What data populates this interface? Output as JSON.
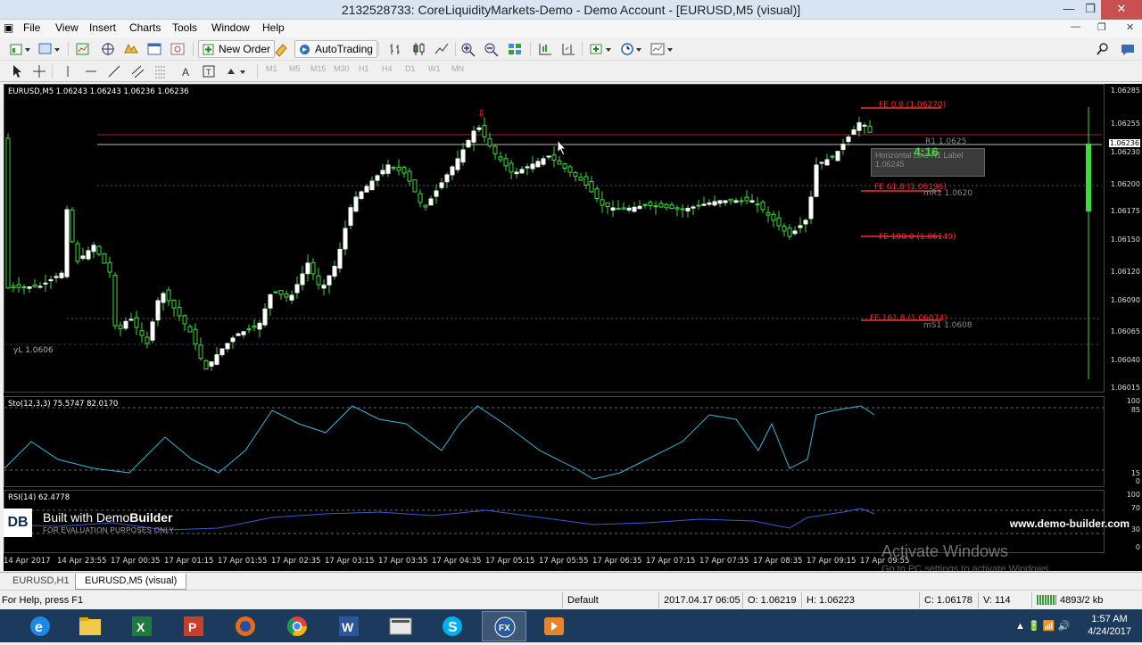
{
  "window": {
    "title": "2132528733: CoreLiquidityMarkets-Demo - Demo Account - [EURUSD,M5 (visual)]",
    "min_icon": "minimize-icon",
    "max_icon": "restore-icon",
    "close_icon": "close-icon"
  },
  "menu": [
    "File",
    "View",
    "Insert",
    "Charts",
    "Tools",
    "Window",
    "Help"
  ],
  "toolbar": {
    "new_order": "New Order",
    "auto_trading": "AutoTrading"
  },
  "timeframes": [
    "M1",
    "M5",
    "M15",
    "M30",
    "H1",
    "H4",
    "D1",
    "W1",
    "MN"
  ],
  "chart": {
    "header": "EURUSD,M5  1.06243 1.06243 1.06236 1.06236",
    "symbol": "EURUSD",
    "timeframe": "M5",
    "current_price": "1.06236",
    "price_axis": [
      "1.06285",
      "1.06255",
      "1.06230",
      "1.06200",
      "1.06175",
      "1.06150",
      "1.06120",
      "1.06090",
      "1.06065",
      "1.06040",
      "1.06015"
    ],
    "levels": [
      {
        "label": "FE 0.0  (1.06270)",
        "color": "#ff2a2a"
      },
      {
        "label": "R1 1.0625",
        "color": "#888888"
      },
      {
        "label": "FE 61.8  (1.06196)",
        "color": "#ff2a2a"
      },
      {
        "label": "mR1 1.0620",
        "color": "#888888"
      },
      {
        "label": "FE 100.0  (1.06149)",
        "color": "#ff2a2a"
      },
      {
        "label": "FE 161.8  (1.06074)",
        "color": "#ff2a2a"
      },
      {
        "label": "mS1 1.0608",
        "color": "#888888"
      },
      {
        "label": "yL 1.0606",
        "color": "#aaaaaa"
      }
    ],
    "tooltip": "Horizontal Line R1 Label\n1.06245",
    "timer": "4:16"
  },
  "stochastic": {
    "header": "Sto(12,3,3) 75.5747 82.0170",
    "axis": [
      "100",
      "85",
      "15",
      "0"
    ]
  },
  "rsi": {
    "header": "RSI(14) 62.4778",
    "axis": [
      "100",
      "70",
      "30",
      "0"
    ]
  },
  "time_axis": [
    "14 Apr 2017",
    "14 Apr 23:55",
    "17 Apr 00:35",
    "17 Apr 01:15",
    "17 Apr 01:55",
    "17 Apr 02:35",
    "17 Apr 03:15",
    "17 Apr 03:55",
    "17 Apr 04:35",
    "17 Apr 05:15",
    "17 Apr 05:55",
    "17 Apr 06:35",
    "17 Apr 07:15",
    "17 Apr 07:55",
    "17 Apr 08:35",
    "17 Apr 09:15",
    "17 Apr 09:55"
  ],
  "banner": {
    "logo": "DB",
    "title_prefix": "Built with Demo",
    "title_bold": "Builder",
    "subtitle": "FOR EVALUATION PURPOSES ONLY",
    "url": "www.demo-builder.com"
  },
  "activate": {
    "title": "Activate Windows",
    "subtitle": "Go to PC settings to activate Windows."
  },
  "tabs": [
    "EURUSD,H1",
    "EURUSD,M5 (visual)"
  ],
  "status": {
    "help": "For Help, press F1",
    "profile": "Default",
    "datetime": "2017.04.17 06:05",
    "open": "O: 1.06219",
    "high": "H: 1.06223",
    "close": "C: 1.06178",
    "volume": "V: 114",
    "traffic": "4893/2 kb"
  },
  "taskbar": {
    "apps": [
      "internet-explorer-icon",
      "file-explorer-icon",
      "excel-icon",
      "powerpoint-icon",
      "firefox-icon",
      "chrome-icon",
      "word-icon",
      "generic-app-icon",
      "skype-icon",
      "fx-terminal-icon",
      "media-player-icon"
    ],
    "time": "1:57 AM",
    "date": "4/24/2017"
  }
}
